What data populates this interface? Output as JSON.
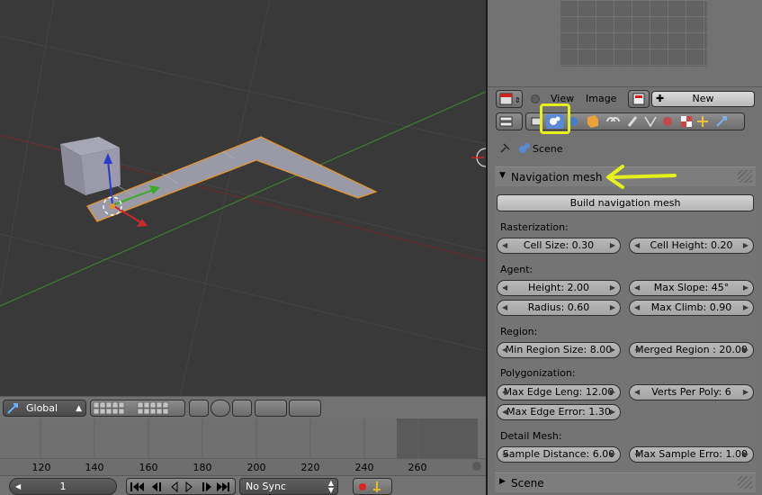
{
  "viewport": {
    "orientation_label": "Global",
    "colors": {
      "bg": "#393939",
      "grid": "#4a4a4a",
      "x_axis": "#7a2a2a",
      "y_axis": "#3a8a2a",
      "mesh": "#9a9aa6",
      "selection": "#e88a2a"
    }
  },
  "timeline": {
    "ticks": [
      "120",
      "140",
      "160",
      "180",
      "200",
      "220",
      "240",
      "260"
    ],
    "current_frame": "1",
    "sync_mode": "No Sync"
  },
  "image_editor": {
    "menu_view": "View",
    "menu_image": "Image",
    "new_button": "New"
  },
  "properties": {
    "context_label": "Scene",
    "navmesh_panel": {
      "title": "Navigation mesh",
      "build_button": "Build navigation mesh",
      "rasterization": {
        "heading": "Rasterization:",
        "cell_size": "Cell Size: 0.30",
        "cell_height": "Cell Height: 0.20"
      },
      "agent": {
        "heading": "Agent:",
        "height": "Height: 2.00",
        "max_slope": "Max Slope: 45°",
        "radius": "Radius: 0.60",
        "max_climb": "Max Climb: 0.90"
      },
      "region": {
        "heading": "Region:",
        "min_region_size": "Min Region Size: 8.00",
        "merged_region": "Merged Region : 20.00"
      },
      "polygonization": {
        "heading": "Polygonization:",
        "max_edge_len": "Max Edge Leng: 12.00",
        "verts_per_poly": "Verts Per Poly: 6",
        "max_edge_error": "Max Edge Error: 1.30"
      },
      "detail_mesh": {
        "heading": "Detail Mesh:",
        "sample_distance": "Sample Distance: 6.00",
        "max_sample_error": "Max Sample Erro: 1.00"
      }
    },
    "scene_panel": {
      "title": "Scene"
    }
  },
  "annotation": {
    "highlight_color": "#e4f21a"
  }
}
